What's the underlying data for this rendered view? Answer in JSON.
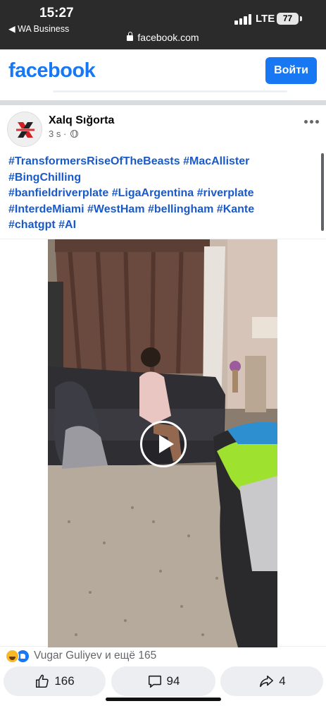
{
  "status_bar": {
    "time": "15:27",
    "back_app": "◀ WA Business",
    "network": "LTE",
    "battery": "77"
  },
  "browser": {
    "url": "facebook.com"
  },
  "fb_header": {
    "logo": "facebook",
    "login_button": "Войти"
  },
  "post": {
    "page_name": "Xalq Sığorta",
    "time": "3 s",
    "separator": "·",
    "audience_icon": "globe-icon",
    "more_icon": "more-dots-icon",
    "hashtag_lines": [
      "#TransformersRiseOfTheBeasts #MacAllister",
      "#BingChilling",
      "#banfieldriverplate #LigaArgentina #riverplate",
      "#InterdeMiami #WestHam #bellingham #Kante",
      "#chatgpt #AI"
    ],
    "video": {
      "play_icon": "play-icon"
    },
    "reactions": {
      "icons": [
        "haha-icon",
        "like-icon"
      ],
      "text": "Vugar Guliyev и ещё 165"
    },
    "actions": {
      "like_count": "166",
      "comment_count": "94",
      "share_count": "4"
    }
  },
  "colors": {
    "brand": "#1877f2",
    "hashtag": "#1a5ac8",
    "status_bar_bg": "#2b2b2b",
    "button_bg": "#eceef1"
  }
}
